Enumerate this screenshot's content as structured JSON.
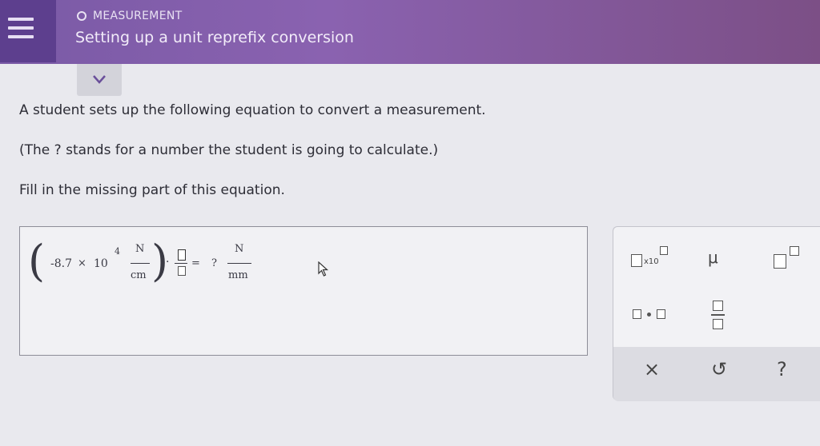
{
  "header": {
    "topic": "MEASUREMENT",
    "title": "Setting up a unit reprefix conversion"
  },
  "question": {
    "line1": "A student sets up the following equation to convert a measurement.",
    "line2": "(The ? stands for a number the student is going to calculate.)",
    "line3": "Fill in the missing part of this equation."
  },
  "equation": {
    "coefficient": "-8.7",
    "times": "×",
    "base": "10",
    "exponent": "4",
    "unit_num": "N",
    "unit_den": "cm",
    "dot": "·",
    "equals": "=",
    "unknown": "?",
    "result_num": "N",
    "result_den": "mm"
  },
  "palette": {
    "x10_label": "x10",
    "mu_label": "μ",
    "clear_label": "×",
    "undo_label": "↺",
    "help_label": "?"
  }
}
